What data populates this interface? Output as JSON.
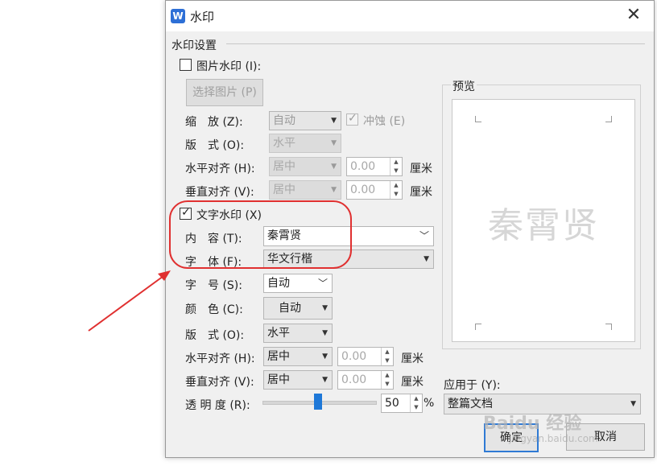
{
  "title": "水印",
  "close": "✕",
  "group_title": "水印设置",
  "picture": {
    "checkbox_label": "图片水印 (I):",
    "select_button": "选择图片 (P)",
    "scale_label": "缩　放 (Z):",
    "scale_value": "自动",
    "washout_label": "冲蚀 (E)",
    "layout_label": "版　式 (O):",
    "layout_value": "水平",
    "halign_label": "水平对齐 (H):",
    "halign_value": "居中",
    "halign_offset": "0.00",
    "valign_label": "垂直对齐 (V):",
    "valign_value": "居中",
    "valign_offset": "0.00",
    "unit": "厘米"
  },
  "text": {
    "checkbox_label": "文字水印 (X)",
    "content_label": "内　容 (T):",
    "content_value": "秦霄贤",
    "font_label": "字　体 (F):",
    "font_value": "华文行楷",
    "size_label": "字　号 (S):",
    "size_value": "自动",
    "color_label": "颜　色 (C):",
    "color_value": "自动",
    "layout_label": "版　式 (O):",
    "layout_value": "水平",
    "halign_label": "水平对齐 (H):",
    "halign_value": "居中",
    "halign_offset": "0.00",
    "valign_label": "垂直对齐 (V):",
    "valign_value": "居中",
    "valign_offset": "0.00",
    "unit": "厘米",
    "transparency_label": "透 明 度 (R):",
    "transparency_value": "50",
    "percent": "%"
  },
  "preview": {
    "label": "预览",
    "watermark": "秦霄贤"
  },
  "apply": {
    "label": "应用于 (Y):",
    "value": "整篇文档"
  },
  "buttons": {
    "ok": "确定",
    "cancel": "取消"
  },
  "overlay": {
    "watermark_brand": "Baidu 经验",
    "watermark_url": "jingyan.baidu.com"
  },
  "colors": {
    "accent": "#2d6fd6",
    "annotation": "#e03030"
  }
}
